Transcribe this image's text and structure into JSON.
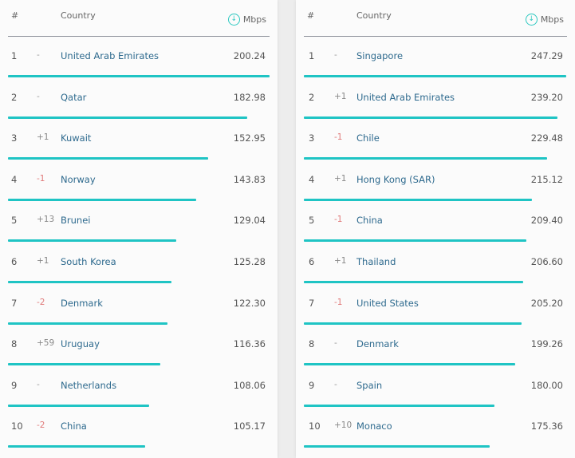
{
  "header": {
    "rank": "#",
    "country": "Country",
    "speed_unit": "Mbps",
    "speed_icon": "download-circle-icon"
  },
  "colors": {
    "bar": "#1fc4c4",
    "country_link": "#2e6a8e",
    "change_down": "#e07a7a",
    "change_up": "#888888"
  },
  "left_table": {
    "rows": [
      {
        "rank": "1",
        "change": "-",
        "country": "United Arab Emirates",
        "mbps": "200.24"
      },
      {
        "rank": "2",
        "change": "-",
        "country": "Qatar",
        "mbps": "182.98"
      },
      {
        "rank": "3",
        "change": "+1",
        "country": "Kuwait",
        "mbps": "152.95"
      },
      {
        "rank": "4",
        "change": "-1",
        "country": "Norway",
        "mbps": "143.83"
      },
      {
        "rank": "5",
        "change": "+13",
        "country": "Brunei",
        "mbps": "129.04"
      },
      {
        "rank": "6",
        "change": "+1",
        "country": "South Korea",
        "mbps": "125.28"
      },
      {
        "rank": "7",
        "change": "-2",
        "country": "Denmark",
        "mbps": "122.30"
      },
      {
        "rank": "8",
        "change": "+59",
        "country": "Uruguay",
        "mbps": "116.36"
      },
      {
        "rank": "9",
        "change": "-",
        "country": "Netherlands",
        "mbps": "108.06"
      },
      {
        "rank": "10",
        "change": "-2",
        "country": "China",
        "mbps": "105.17"
      }
    ]
  },
  "right_table": {
    "rows": [
      {
        "rank": "1",
        "change": "-",
        "country": "Singapore",
        "mbps": "247.29"
      },
      {
        "rank": "2",
        "change": "+1",
        "country": "United Arab Emirates",
        "mbps": "239.20"
      },
      {
        "rank": "3",
        "change": "-1",
        "country": "Chile",
        "mbps": "229.48"
      },
      {
        "rank": "4",
        "change": "+1",
        "country": "Hong Kong (SAR)",
        "mbps": "215.12"
      },
      {
        "rank": "5",
        "change": "-1",
        "country": "China",
        "mbps": "209.40"
      },
      {
        "rank": "6",
        "change": "+1",
        "country": "Thailand",
        "mbps": "206.60"
      },
      {
        "rank": "7",
        "change": "-1",
        "country": "United States",
        "mbps": "205.20"
      },
      {
        "rank": "8",
        "change": "-",
        "country": "Denmark",
        "mbps": "199.26"
      },
      {
        "rank": "9",
        "change": "-",
        "country": "Spain",
        "mbps": "180.00"
      },
      {
        "rank": "10",
        "change": "+10",
        "country": "Monaco",
        "mbps": "175.36"
      }
    ]
  }
}
